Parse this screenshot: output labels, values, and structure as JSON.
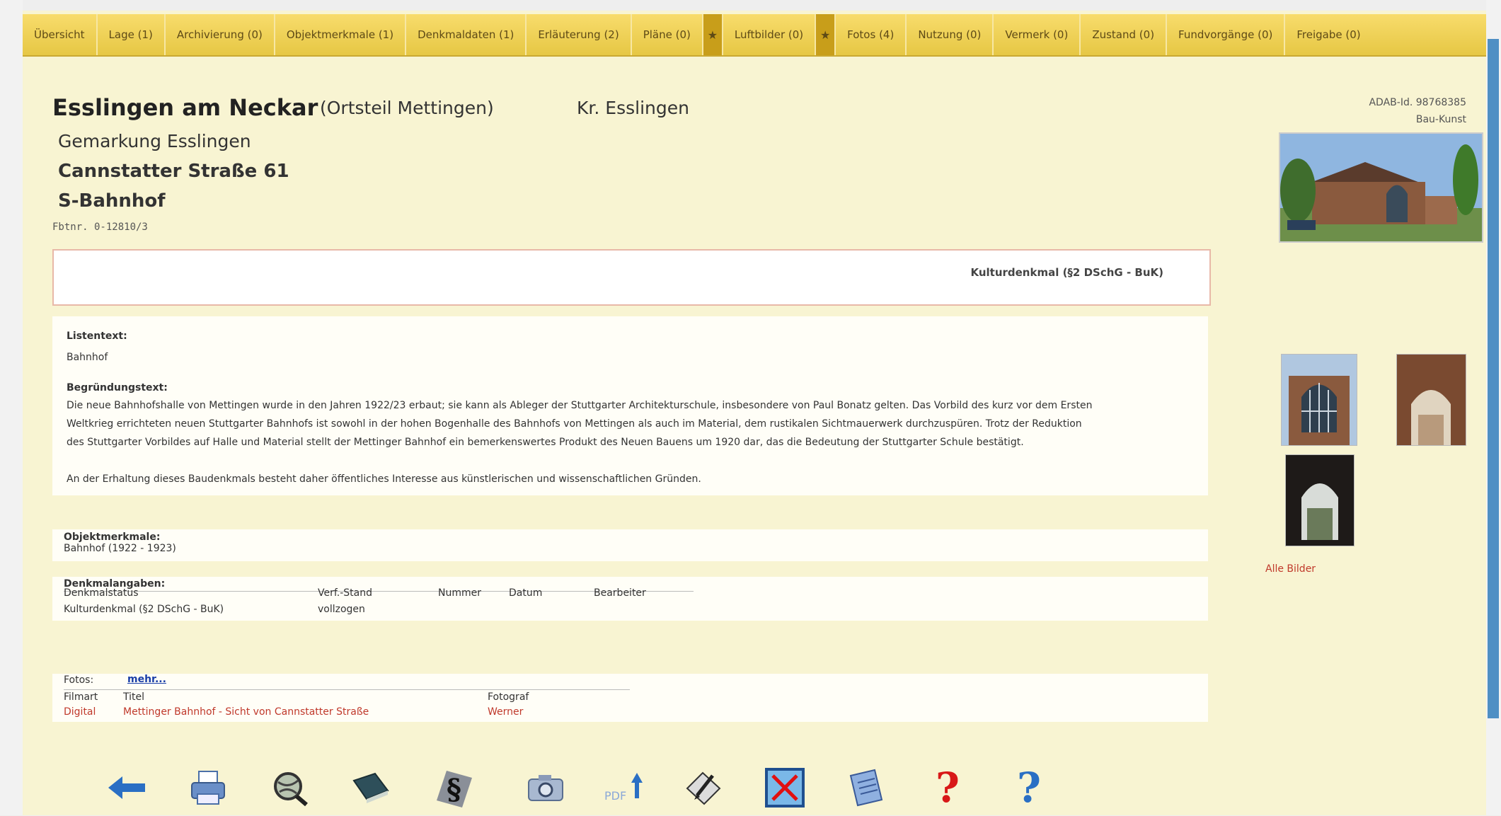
{
  "nav": {
    "tabs": [
      "Übersicht",
      "Lage (1)",
      "Archivierung (0)",
      "Objektmerkmale (1)",
      "Denkmaldaten (1)",
      "Erläuterung (2)",
      "Pläne (0)",
      "Luftbilder (0)",
      "Fotos (4)",
      "Nutzung (0)",
      "Vermerk (0)",
      "Zustand (0)",
      "Fundvorgänge (0)",
      "Freigabe (0)"
    ]
  },
  "header": {
    "city": "Esslingen am Neckar",
    "ortsteil": "(Ortsteil Mettingen)",
    "kreis": "Kr. Esslingen",
    "gemarkung": "Gemarkung Esslingen",
    "street": "Cannstatter Straße 61",
    "object": "S-Bahnhof",
    "foto_nr": "Fbtnr. 0-12810/3",
    "adab_id": "ADAB-Id. 98768385",
    "category": "Bau-Kunst"
  },
  "status": {
    "label": "Kulturdenkmal (§2 DSchG - BuK)"
  },
  "listentext": {
    "label": "Listentext:",
    "value": "Bahnhof"
  },
  "begruendung": {
    "label": "Begründungstext:",
    "lines": [
      "Die neue Bahnhofshalle von Mettingen wurde in den Jahren 1922/23 erbaut; sie kann als Ableger der Stuttgarter Architekturschule, insbesondere von Paul Bonatz gelten. Das Vorbild des kurz vor dem Ersten",
      "Weltkrieg errichteten neuen Stuttgarter Bahnhofs ist sowohl in der hohen Bogenhalle des Bahnhofs von Mettingen als auch im Material, dem rustikalen Sichtmauerwerk durchzuspüren. Trotz der Reduktion",
      "des Stuttgarter Vorbildes auf Halle und Material stellt der Mettinger Bahnhof ein bemerkenswertes Produkt des Neuen Bauens um 1920 dar, das die Bedeutung der Stuttgarter Schule bestätigt."
    ],
    "closing": "An der Erhaltung dieses Baudenkmals besteht daher öffentliches Interesse aus künstlerischen und wissenschaftlichen Gründen."
  },
  "objektmerkmale": {
    "label": "Objektmerkmale:",
    "value": "Bahnhof (1922 - 1923)"
  },
  "denkmalangaben": {
    "label": "Denkmalangaben:",
    "headers": [
      "Denkmalstatus",
      "Verf.-Stand",
      "Nummer",
      "Datum",
      "Bearbeiter"
    ],
    "row": [
      "Kulturdenkmal (§2 DSchG - BuK)",
      "vollzogen",
      "",
      "",
      ""
    ]
  },
  "fotos": {
    "label": "Fotos:",
    "more": "mehr...",
    "headers": [
      "Filmart",
      "Titel",
      "Fotograf"
    ],
    "row": [
      "Digital",
      "Mettinger Bahnhof - Sicht von Cannstatter Straße",
      "Werner"
    ]
  },
  "sidebar": {
    "all_images": "Alle Bilder"
  },
  "toolbar": {
    "pdf": "PDF",
    "help_red": "?",
    "help_blue": "?",
    "icons": [
      "arrow-left-icon",
      "printer-icon",
      "globe-search-icon",
      "book-icon",
      "paragraph-icon",
      "camera-icon",
      "pdf-upload-icon",
      "edit-pencil-icon",
      "close-x-icon",
      "notepad-icon",
      "help-red-icon",
      "help-blue-icon"
    ]
  },
  "colors": {
    "page_bg": "#f8f4d2",
    "nav_bg": "#e6c744",
    "accent_red": "#c0392b",
    "link_blue": "#1a3ea8"
  }
}
